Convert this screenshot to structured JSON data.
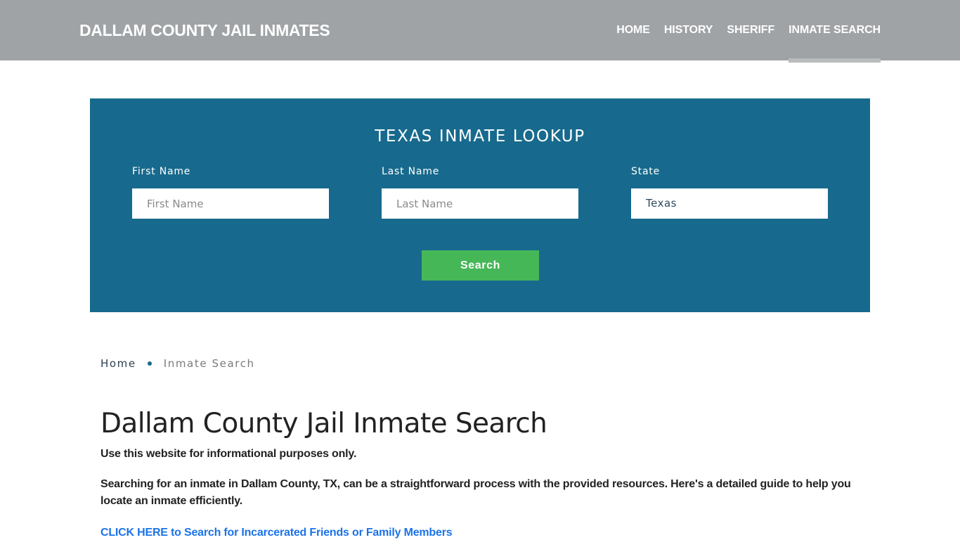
{
  "header": {
    "brand": "DALLAM COUNTY JAIL INMATES",
    "nav": [
      {
        "label": "HOME",
        "active": false
      },
      {
        "label": "HISTORY",
        "active": false
      },
      {
        "label": "SHERIFF",
        "active": false
      },
      {
        "label": "INMATE SEARCH",
        "active": true
      }
    ]
  },
  "lookup": {
    "title": "TEXAS INMATE LOOKUP",
    "fields": [
      {
        "label": "First Name",
        "placeholder": "First Name",
        "value": ""
      },
      {
        "label": "Last Name",
        "placeholder": "Last Name",
        "value": ""
      },
      {
        "label": "State",
        "value": "Texas"
      }
    ],
    "search_label": "Search",
    "colors": {
      "panel": "#176a8d",
      "button": "#45b757"
    }
  },
  "breadcrumb": {
    "items": [
      "Home",
      "Inmate Search"
    ]
  },
  "main": {
    "title": "Dallam County Jail Inmate Search",
    "disclaimer": "Use this website for informational purposes only.",
    "intro": "Searching for an inmate in Dallam County, TX, can be a straightforward process with the provided resources. Here's a detailed guide to help you locate an inmate efficiently.",
    "cta_link": "CLICK HERE to Search for Incarcerated Friends or Family Members"
  }
}
